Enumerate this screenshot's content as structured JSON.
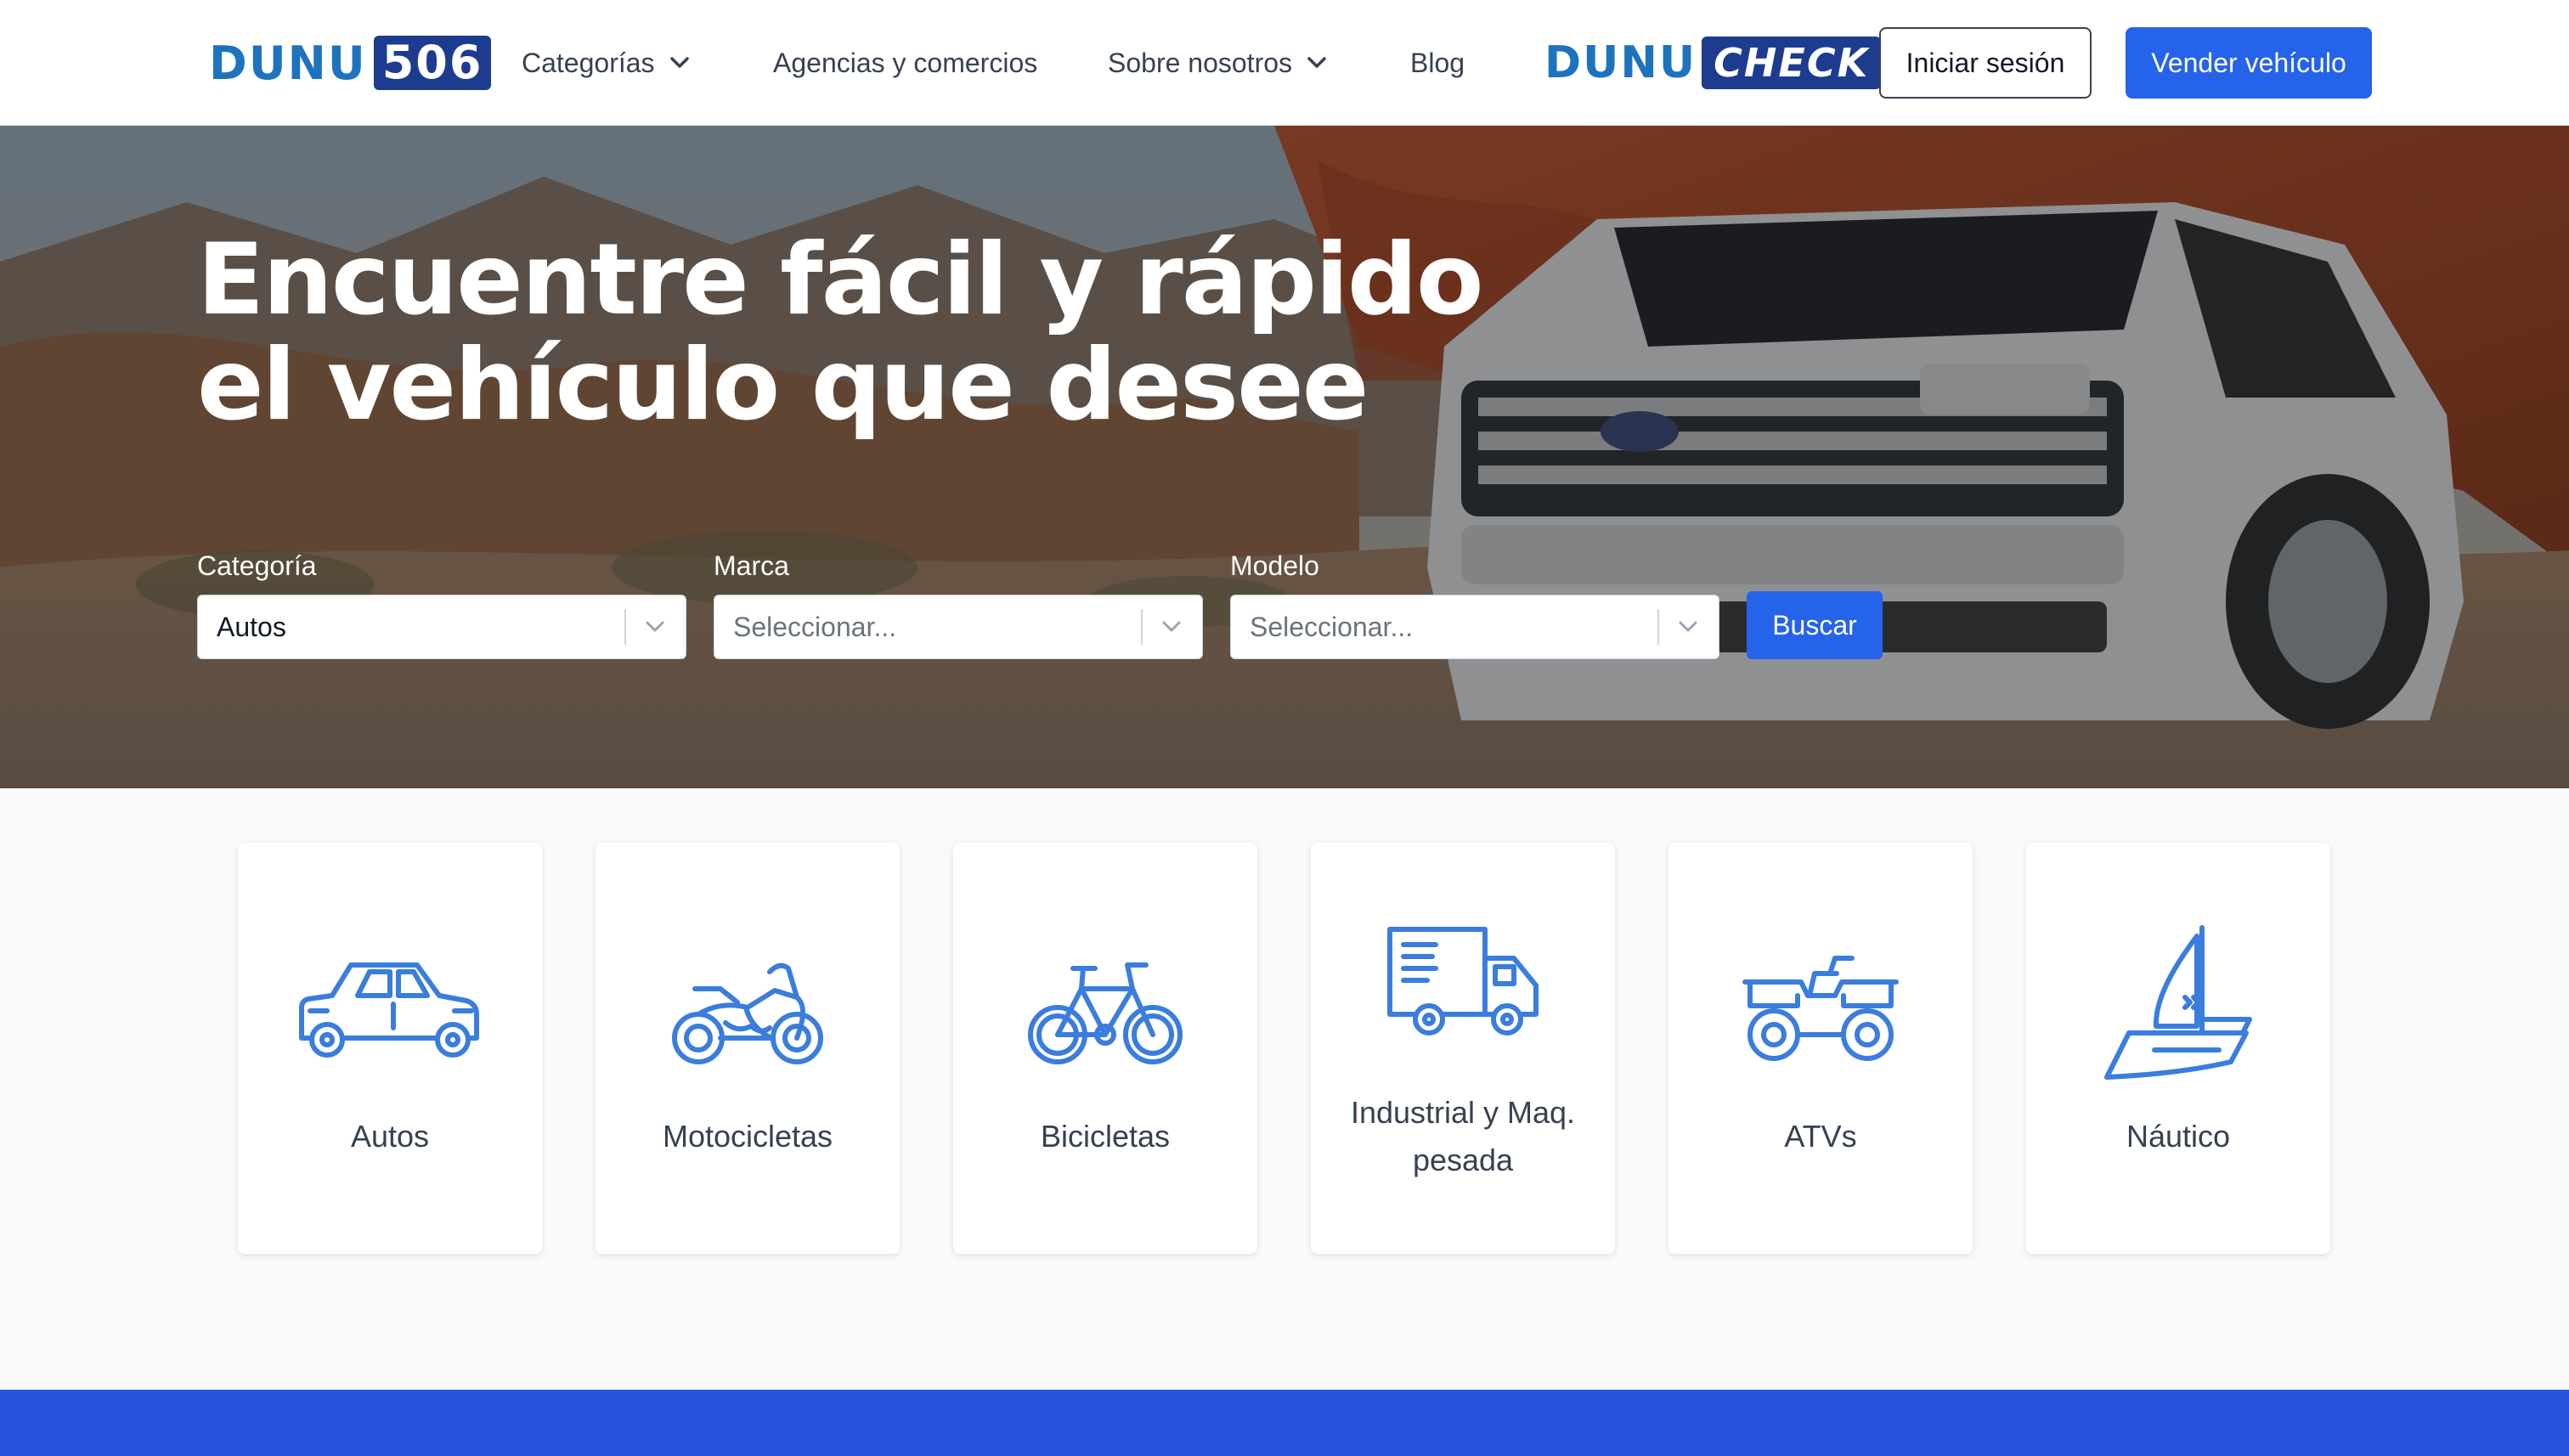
{
  "brand": {
    "logo_word": "DUNU",
    "logo_box": "506"
  },
  "nav": {
    "items": [
      {
        "label": "Categorías"
      },
      {
        "label": "Agencias y comercios"
      },
      {
        "label": "Sobre nosotros"
      },
      {
        "label": "Blog"
      }
    ],
    "check_logo_word": "DUNU",
    "check_logo_box": "CHECK",
    "login_label": "Iniciar sesión",
    "sell_label": "Vender vehículo"
  },
  "hero": {
    "title_line1": "Encuentre fácil y rápido",
    "title_line2": "el vehículo que desee",
    "filters": {
      "category": {
        "label": "Categoría",
        "value": "Autos"
      },
      "brand": {
        "label": "Marca",
        "placeholder": "Seleccionar..."
      },
      "model": {
        "label": "Modelo",
        "placeholder": "Seleccionar..."
      }
    },
    "search_label": "Buscar"
  },
  "categories": [
    {
      "label": "Autos",
      "icon": "car-icon"
    },
    {
      "label": "Motocicletas",
      "icon": "motorcycle-icon"
    },
    {
      "label": "Bicicletas",
      "icon": "bicycle-icon"
    },
    {
      "label_line1": "Industrial y Maq.",
      "label_line2": "pesada",
      "icon": "truck-icon"
    },
    {
      "label": "ATVs",
      "icon": "atv-icon"
    },
    {
      "label": "Náutico",
      "icon": "sailboat-icon"
    }
  ],
  "colors": {
    "accent": "#2563eb",
    "brand_blue": "#1e73be",
    "brand_dark": "#1d3c8f",
    "icon_blue": "#3b7ddd",
    "footer_band": "#2554da"
  }
}
